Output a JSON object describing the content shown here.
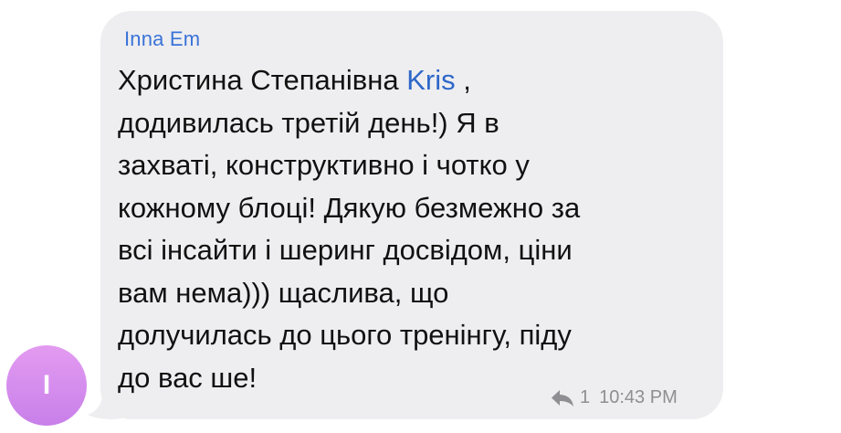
{
  "sender": {
    "name": "Inna Em",
    "avatar_initial": "I"
  },
  "message": {
    "line1_prefix": "Христина Степанівна ",
    "mention": "Kris",
    "line1_suffix": " ,",
    "lines": [
      "додивилась третій день!) Я в",
      "захваті, конструктивно і чотко у",
      "кожному блоці! Дякую безмежно за",
      "всі інсайти і шеринг досвідом, ціни",
      "вам нема))) щаслива, що",
      "долучилась до цього тренінгу, піду",
      "до вас ше!"
    ]
  },
  "meta": {
    "reply_count": "1",
    "time": "10:43 PM",
    "reply_icon": "reply-arrow-icon"
  },
  "colors": {
    "bubble": "#eeeef0",
    "sender_name": "#3a73d8",
    "mention": "#2e67c9",
    "meta_text": "#8e8e93",
    "avatar_top": "#e39bf1",
    "avatar_bottom": "#c880ea"
  }
}
